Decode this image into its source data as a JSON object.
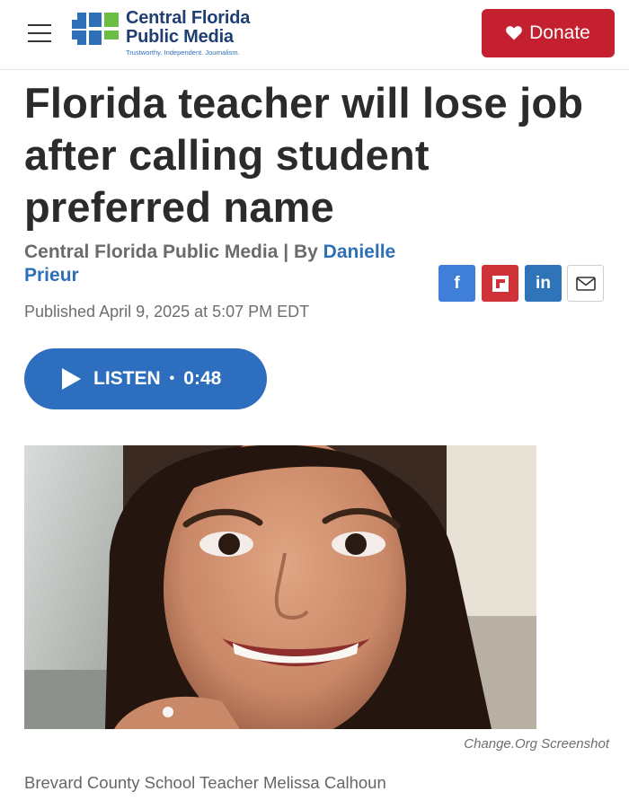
{
  "header": {
    "menu_icon": "hamburger-menu-icon",
    "logo": {
      "line1": "Central Florida",
      "line2": "Public Media",
      "tagline": "Trustworthy. Independent. Journalism.",
      "colors": [
        "#2e6fb7",
        "#6cbd45",
        "#1f3f73"
      ]
    },
    "donate": {
      "label": "Donate",
      "icon": "heart-icon",
      "color": "#c4202f"
    }
  },
  "article": {
    "headline_lines": [
      "Florida teacher will lose job",
      "after calling student",
      "preferred name"
    ],
    "byline": {
      "source": "Central Florida Public Media",
      "separator": "|",
      "by": "By",
      "author_first": "Danielle",
      "author_last": "Prieur"
    },
    "published": "Published April 9, 2025 at 5:07 PM EDT",
    "share": [
      {
        "network": "facebook",
        "glyph": "f",
        "color": "#3f7fd9"
      },
      {
        "network": "flipboard",
        "glyph": "flipboard-icon",
        "color": "#d0323a"
      },
      {
        "network": "linkedin",
        "glyph": "in",
        "color": "#2f73b8"
      },
      {
        "network": "email",
        "glyph": "mail-icon",
        "color": "#ffffff"
      }
    ],
    "listen": {
      "label": "LISTEN",
      "dot": "•",
      "duration": "0:48",
      "color": "#2d6fbe"
    },
    "image": {
      "credit": "Change.Org Screenshot",
      "caption": "Brevard County School Teacher Melissa Calhoun"
    }
  }
}
